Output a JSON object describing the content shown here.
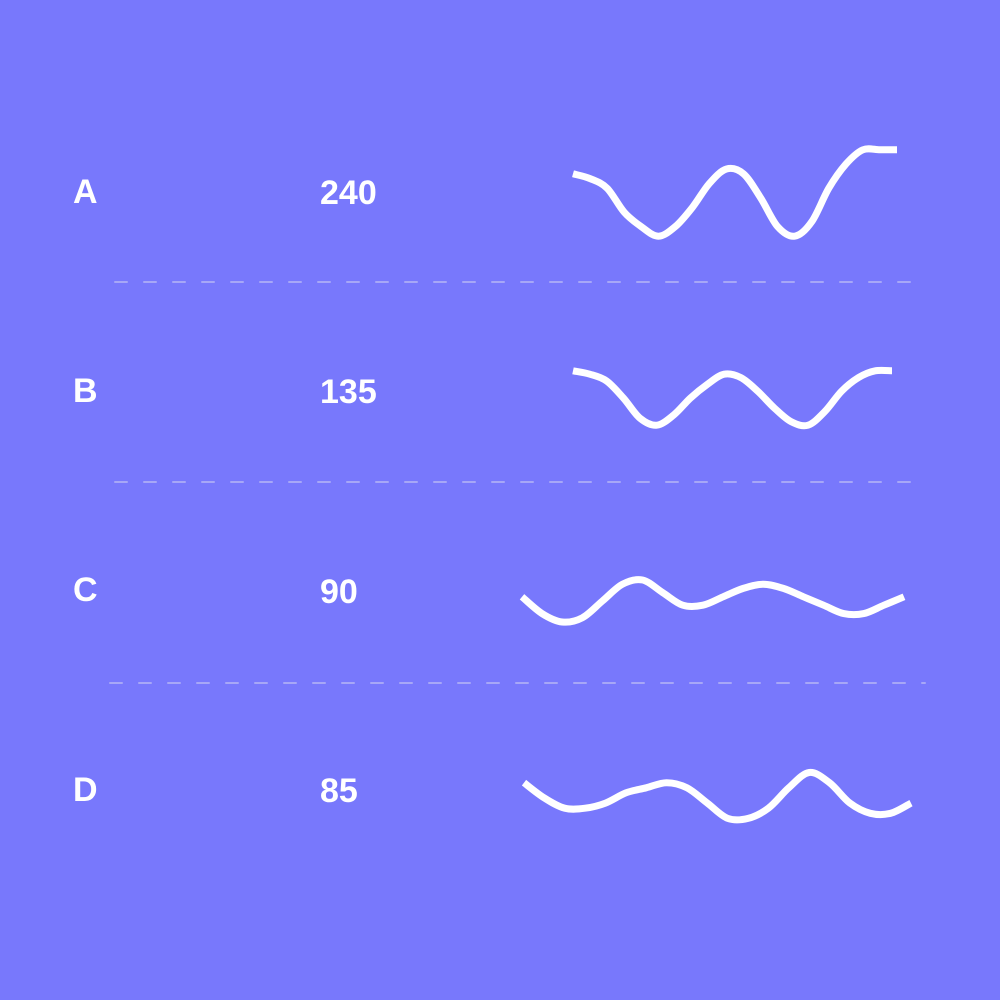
{
  "colors": {
    "background": "#7878fc",
    "text": "#ffffff",
    "line": "#ffffff",
    "divider": "#a7a7f7"
  },
  "chart_data": {
    "type": "table",
    "rows": [
      {
        "label": "A",
        "value": "240",
        "sparkline": [
          0.4,
          0.3,
          0.1,
          -0.4,
          -0.7,
          -0.9,
          -0.7,
          -0.3,
          0.2,
          0.5,
          0.4,
          -0.1,
          -0.7,
          -0.9,
          -0.6,
          0.1,
          0.6,
          0.9,
          0.9,
          0.9
        ]
      },
      {
        "label": "B",
        "value": "135",
        "sparkline": [
          0.8,
          0.7,
          0.5,
          0.0,
          -0.6,
          -0.8,
          -0.5,
          0.0,
          0.4,
          0.7,
          0.6,
          0.2,
          -0.3,
          -0.7,
          -0.8,
          -0.4,
          0.2,
          0.6,
          0.8,
          0.8
        ]
      },
      {
        "label": "C",
        "value": "90",
        "sparkline": [
          0.1,
          -0.3,
          -0.5,
          -0.4,
          0.0,
          0.4,
          0.5,
          0.2,
          -0.1,
          -0.1,
          0.1,
          0.3,
          0.4,
          0.3,
          0.1,
          -0.1,
          -0.3,
          -0.3,
          -0.1,
          0.1
        ]
      },
      {
        "label": "D",
        "value": "85",
        "sparkline": [
          0.3,
          0.0,
          -0.2,
          -0.2,
          -0.1,
          0.1,
          0.2,
          0.3,
          0.2,
          -0.1,
          -0.4,
          -0.4,
          -0.2,
          0.2,
          0.5,
          0.3,
          -0.1,
          -0.3,
          -0.3,
          -0.1
        ]
      }
    ]
  }
}
